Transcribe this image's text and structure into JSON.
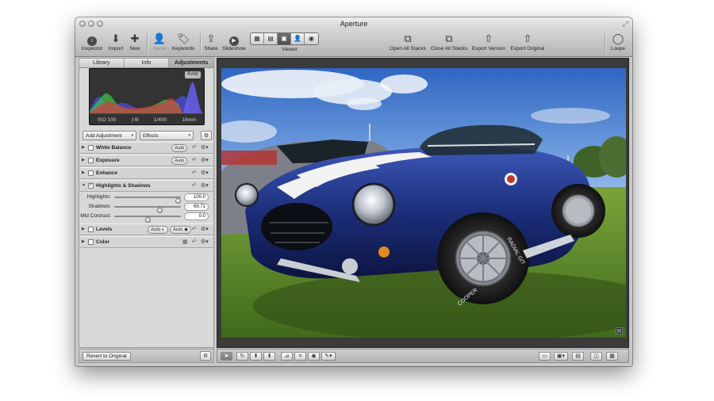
{
  "window": {
    "title": "Aperture"
  },
  "toolbar": {
    "inspector": "Inspector",
    "import": "Import",
    "new": "New",
    "name": "Name",
    "keywords": "Keywords",
    "share": "Share",
    "slideshow": "Slideshow",
    "viewer": "Viewer",
    "open_all_stacks": "Open All Stacks",
    "close_all_stacks": "Close All Stacks",
    "export_version": "Export Version",
    "export_original": "Export Original",
    "loupe": "Loupe"
  },
  "inspector": {
    "tabs": [
      "Library",
      "Info",
      "Adjustments"
    ],
    "active_tab": "Adjustments",
    "histogram": {
      "raw_badge": "RAW",
      "iso": "ISO 100",
      "aperture": "ƒ/8",
      "shutter": "1/400",
      "focal_length": "18mm"
    },
    "add_adjustment": "Add Adjustment",
    "effects": "Effects",
    "adjustments": [
      {
        "name": "White Balance",
        "checked": false,
        "auto": "Auto"
      },
      {
        "name": "Exposure",
        "checked": false,
        "auto": "Auto"
      },
      {
        "name": "Enhance",
        "checked": false
      },
      {
        "name": "Highlights & Shadows",
        "checked": true,
        "expanded": true
      },
      {
        "name": "Levels",
        "checked": false,
        "auto": "Auto",
        "auto2": "Auto"
      },
      {
        "name": "Color",
        "checked": false
      }
    ],
    "highlights_shadows": {
      "highlights_label": "Highlights:",
      "highlights_value": "100.0",
      "highlights_fraction": 1.0,
      "shadows_label": "Shadows:",
      "shadows_value": "69.71",
      "shadows_fraction": 0.6971,
      "mid_contrast_label": "Mid Contrast:",
      "mid_contrast_value": "0.0",
      "mid_contrast_fraction": 0.5
    },
    "revert_button": "Revert to Original"
  },
  "photo": {
    "subject": "blue-roadster-car",
    "tire_text": "COOPER",
    "tire_text2": "RADIAL G/T"
  },
  "colors": {
    "histogram_red": "#d23b3b",
    "histogram_green": "#3fbf4c",
    "histogram_blue": "#4a4fe0",
    "car_blue": "#1c2e7a",
    "sky_blue": "#4f86d6",
    "grass_green": "#5e8c2a"
  }
}
